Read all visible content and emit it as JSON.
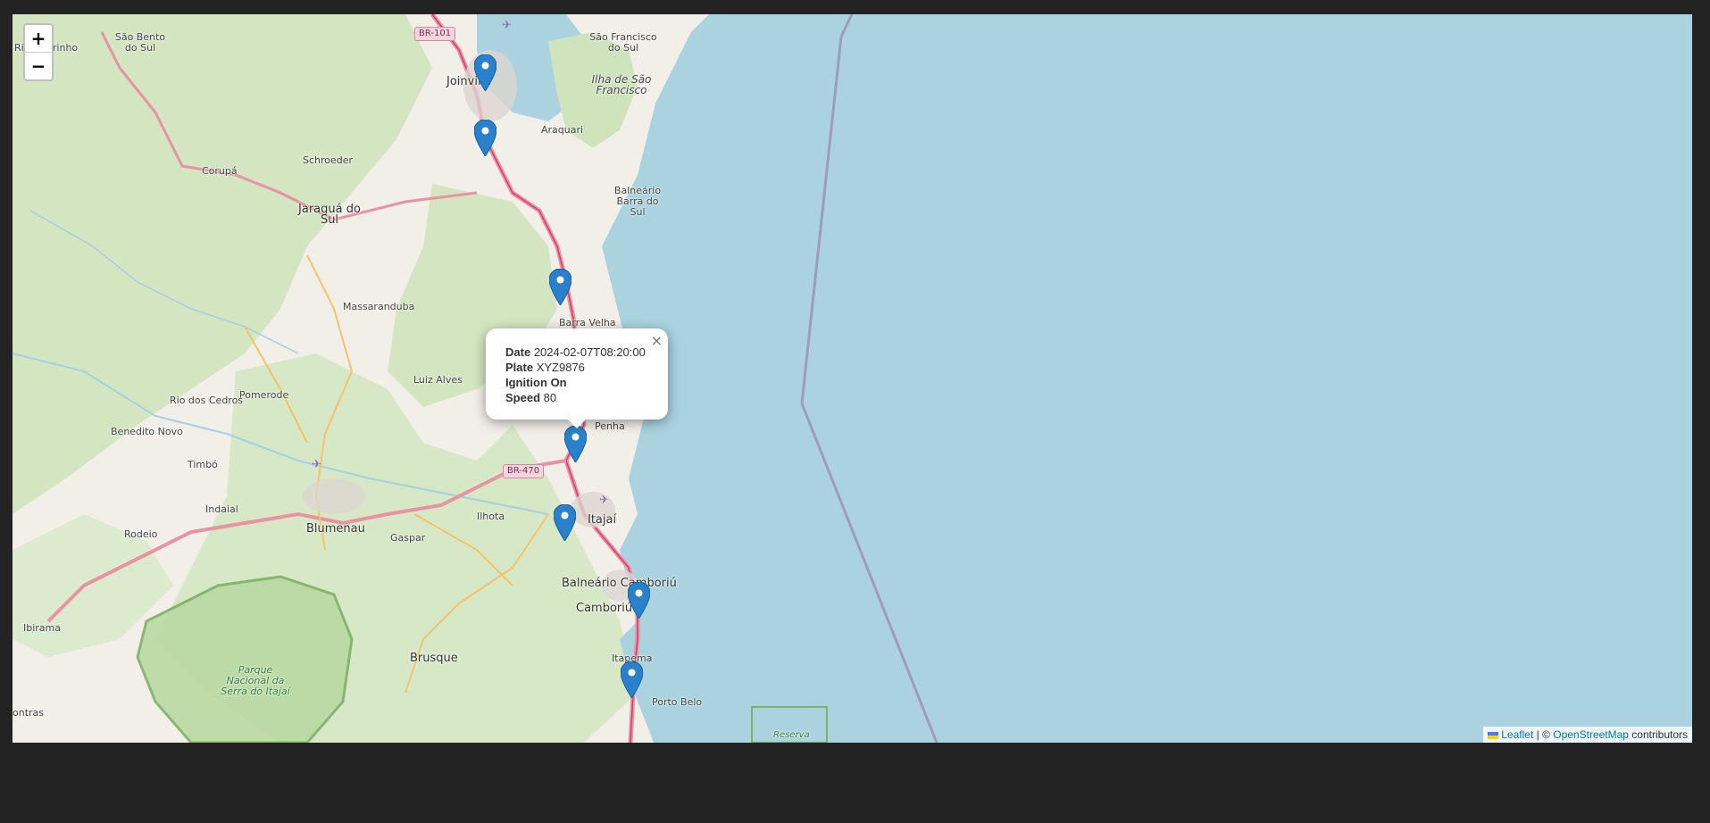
{
  "map": {
    "zoom_in": "+",
    "zoom_out": "−",
    "attribution": {
      "leaflet": "Leaflet",
      "separator": " | © ",
      "osm": "OpenStreetMap",
      "suffix": " contributors"
    },
    "places": [
      {
        "name": "Rio Negrinho"
      },
      {
        "name": "São Bento do Sul"
      },
      {
        "name": "Joinville"
      },
      {
        "name": "São Francisco do Sul"
      },
      {
        "name": "Ilha de São Francisco"
      },
      {
        "name": "Araquari"
      },
      {
        "name": "Schroeder"
      },
      {
        "name": "Corupá"
      },
      {
        "name": "Jaraguá do Sul"
      },
      {
        "name": "Balneário Barra do Sul"
      },
      {
        "name": "Massaranduba"
      },
      {
        "name": "Barra Velha"
      },
      {
        "name": "Luiz Alves"
      },
      {
        "name": "Pomerode"
      },
      {
        "name": "Rio dos Cedros"
      },
      {
        "name": "Benedito Novo"
      },
      {
        "name": "Penha"
      },
      {
        "name": "Timbó"
      },
      {
        "name": "Indaial"
      },
      {
        "name": "Ilhota"
      },
      {
        "name": "Itajaí"
      },
      {
        "name": "Rodeio"
      },
      {
        "name": "Blumenau"
      },
      {
        "name": "Gaspar"
      },
      {
        "name": "Balneário Camboriú"
      },
      {
        "name": "Camboriú"
      },
      {
        "name": "Ibirama"
      },
      {
        "name": "Brusque"
      },
      {
        "name": "Itapema"
      },
      {
        "name": "Porto Belo"
      },
      {
        "name": "Parque Nacional da Serra do Itajaí"
      },
      {
        "name": "ontras"
      },
      {
        "name": "Reserva"
      }
    ],
    "road_shields": [
      "BR-101",
      "BR-470"
    ],
    "popup": {
      "date_label": "Date",
      "date_value": "2024-02-07T08:20:00",
      "plate_label": "Plate",
      "plate_value": "XYZ9876",
      "ignition_label": "Ignition",
      "ignition_value": "On",
      "speed_label": "Speed",
      "speed_value": "80",
      "close": "×"
    },
    "marker_color": "#2a81cb",
    "sea_color": "#aad3df",
    "forest_color": "#c8e0b5"
  }
}
